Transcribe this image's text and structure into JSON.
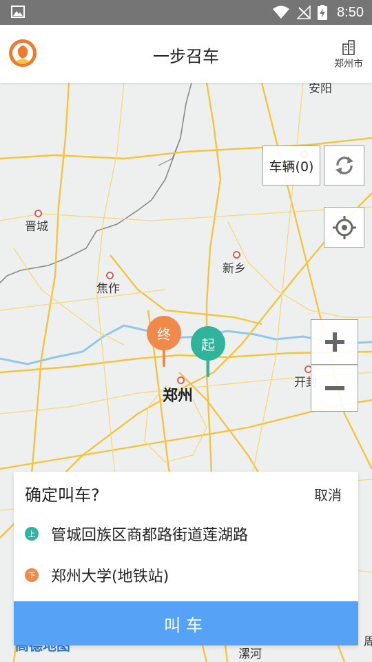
{
  "status_bar": {
    "time": "8:50",
    "icons": [
      "gallery-icon",
      "wifi-icon",
      "no-signal-icon",
      "battery-charging-icon"
    ]
  },
  "header": {
    "title": "一步召车",
    "city": "郑州市",
    "avatar_icon": "user-avatar-icon",
    "city_icon": "building-icon"
  },
  "map": {
    "labels": {
      "anyang": "安阳",
      "jincheng": "晋城",
      "jiaozuo": "焦作",
      "xinxiang": "新乡",
      "zhengzhou": "郑州",
      "kaifeng": "开封",
      "luohe": "漯河",
      "zhou": "周"
    },
    "vehicles_button": "车辆(0)",
    "pin_end": "终",
    "pin_start": "起",
    "logo": "高德地图",
    "colors": {
      "road": "#f5c43c",
      "river": "#8ec8ef",
      "border": "#888888",
      "pin_end": "#f08a4b",
      "pin_start": "#2fb39a"
    }
  },
  "confirm_panel": {
    "title": "确定叫车?",
    "cancel": "取消",
    "pickup_badge": "上",
    "pickup_address": "管城回族区商都路街道莲湖路",
    "dest_badge": "下",
    "dest_address": "郑州大学(地铁站)",
    "call_button": "叫车"
  }
}
